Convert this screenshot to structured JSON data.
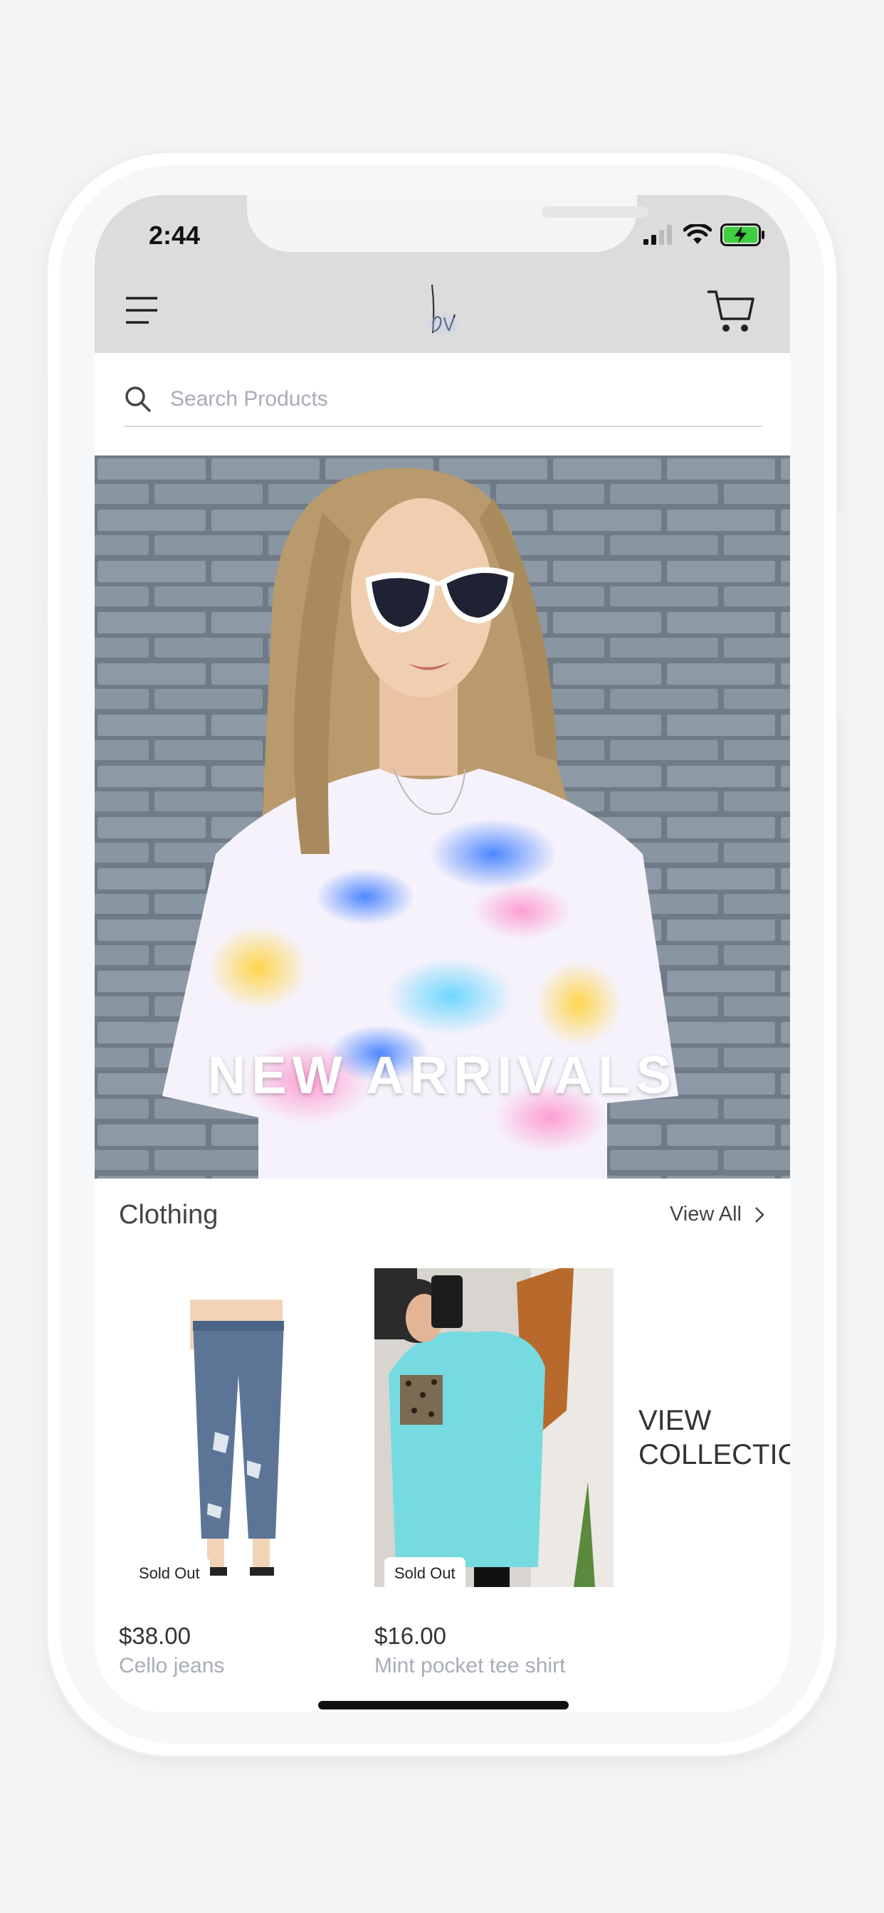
{
  "status_bar": {
    "time": "2:44"
  },
  "header": {
    "logo_text": "bv"
  },
  "search": {
    "placeholder": "Search Products"
  },
  "hero": {
    "title": "NEW ARRIVALS"
  },
  "section": {
    "title": "Clothing",
    "view_all_label": "View All"
  },
  "products": [
    {
      "price": "$38.00",
      "name": "Cello jeans",
      "badge": "Sold Out"
    },
    {
      "price": "$16.00",
      "name": "Mint pocket tee shirt",
      "badge": "Sold Out"
    }
  ],
  "view_collection": {
    "line1": "VIEW",
    "line2": "COLLECTION"
  },
  "colors": {
    "header_bg": "#dcdcdc",
    "page_bg": "#f3f3f3",
    "muted_text": "#a8adb8",
    "battery_green": "#3fce3f"
  }
}
